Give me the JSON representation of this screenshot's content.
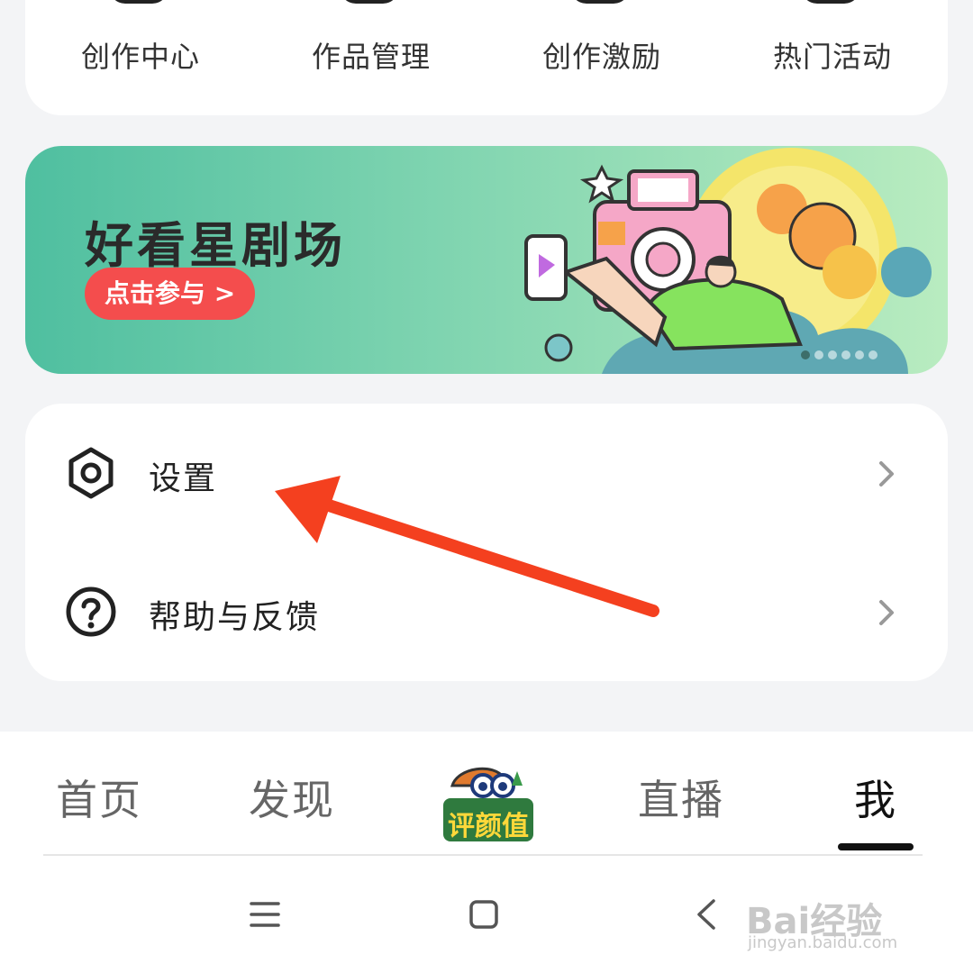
{
  "top_tools": [
    {
      "label": "创作中心",
      "icon": "creation-center-icon"
    },
    {
      "label": "作品管理",
      "icon": "works-manage-icon"
    },
    {
      "label": "创作激励",
      "icon": "creation-incentive-icon"
    },
    {
      "label": "热门活动",
      "icon": "hot-activity-icon"
    }
  ],
  "banner": {
    "title": "好看星剧场",
    "button_label": "点击参与 >",
    "dots_total": 6,
    "dots_active_index": 0
  },
  "menu": {
    "settings_label": "设置",
    "help_label": "帮助与反馈"
  },
  "tabbar": {
    "tabs": [
      "首页",
      "发现",
      "直播",
      "我"
    ],
    "center_badge_text": "评颜值",
    "active_tab": "我"
  },
  "system_nav": {
    "menu_icon": "hamburger-icon",
    "home_icon": "square-home-icon",
    "back_icon": "back-chevron-icon"
  },
  "watermark": {
    "text": "Bai经验",
    "sub": "jingyan.baidu.com"
  },
  "colors": {
    "accent_red": "#f44d4d",
    "arrow": "#f4401f",
    "banner_green": "#4fbfa0"
  }
}
